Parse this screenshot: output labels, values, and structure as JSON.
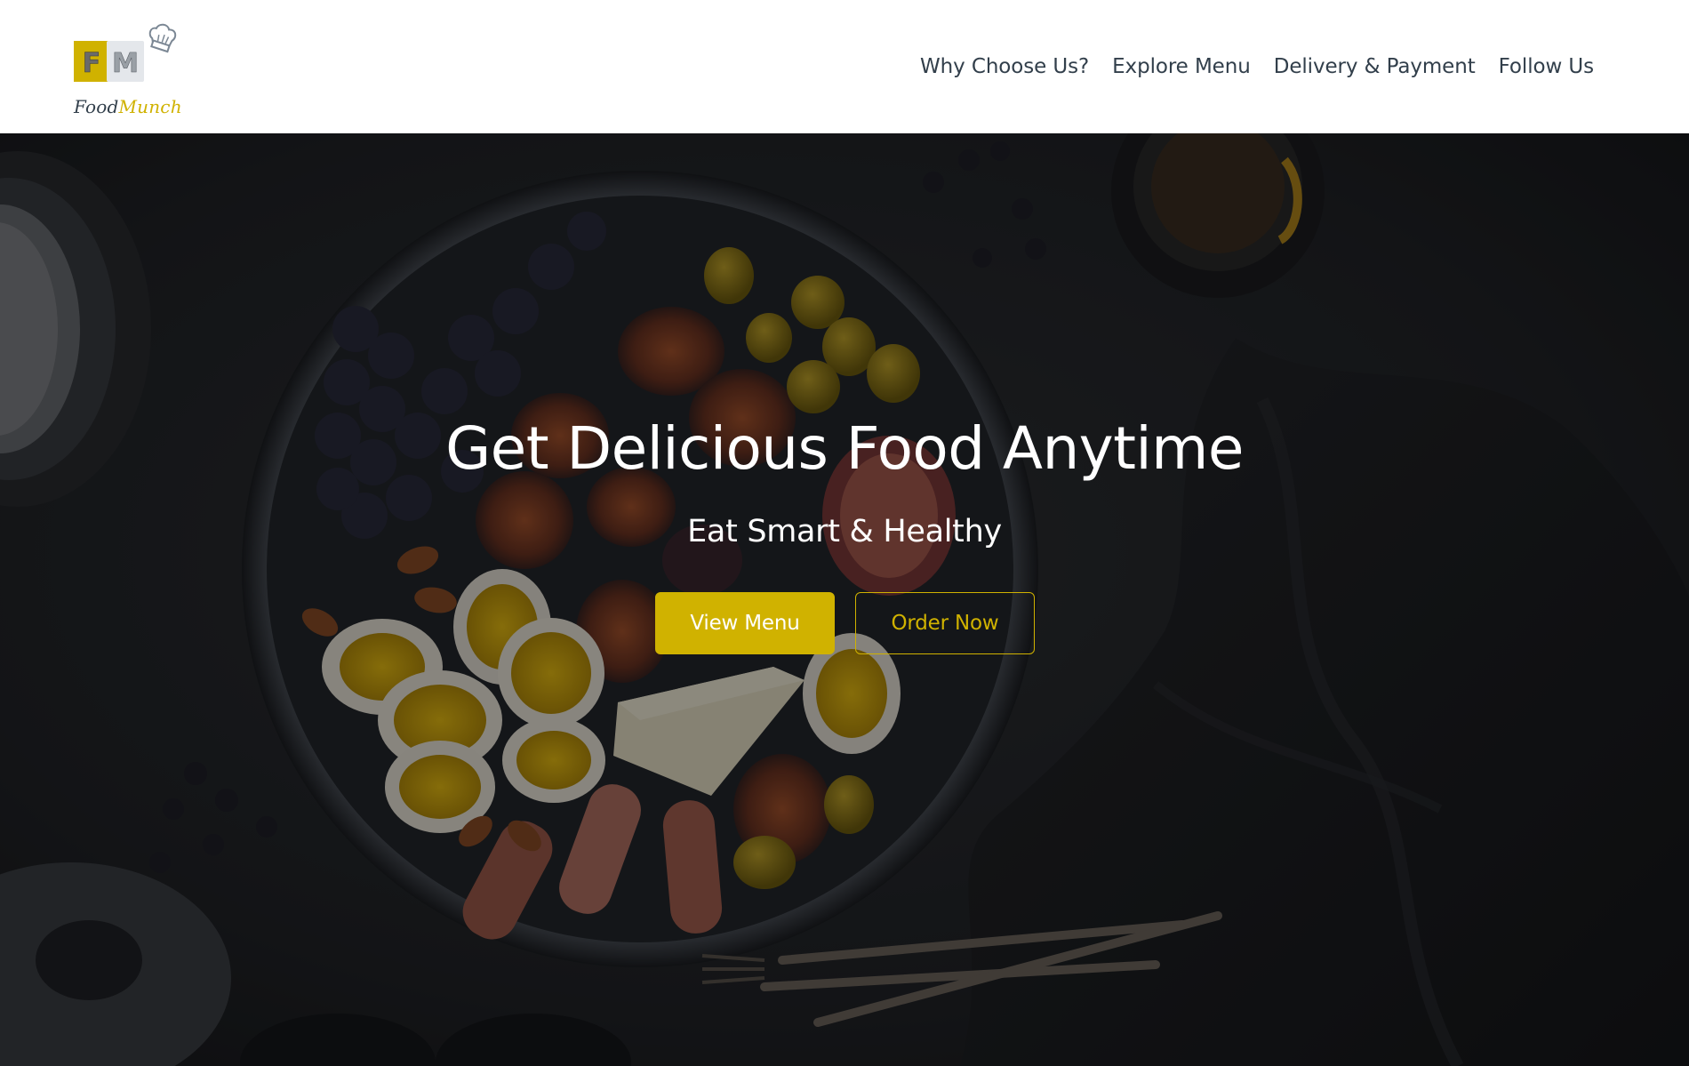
{
  "brand": {
    "logo_letters": [
      "F",
      "M"
    ],
    "name_part1": "Food",
    "name_part2": "Munch",
    "logo_icon": "chef-hat-icon"
  },
  "nav": {
    "links": [
      {
        "label": "Why Choose Us?"
      },
      {
        "label": "Explore Menu"
      },
      {
        "label": "Delivery & Payment"
      },
      {
        "label": "Follow Us"
      }
    ]
  },
  "hero": {
    "title": "Get Delicious Food Anytime",
    "subtitle": "Eat Smart & Healthy",
    "primary_button": "View Menu",
    "secondary_button": "Order Now",
    "background_image": "dark food platter with figs, eggs, grapes, cheese, olives"
  },
  "colors": {
    "accent": "#d0b200",
    "nav_text": "#323f4b",
    "hero_text": "#ffffff",
    "navbar_bg": "#ffffff"
  }
}
